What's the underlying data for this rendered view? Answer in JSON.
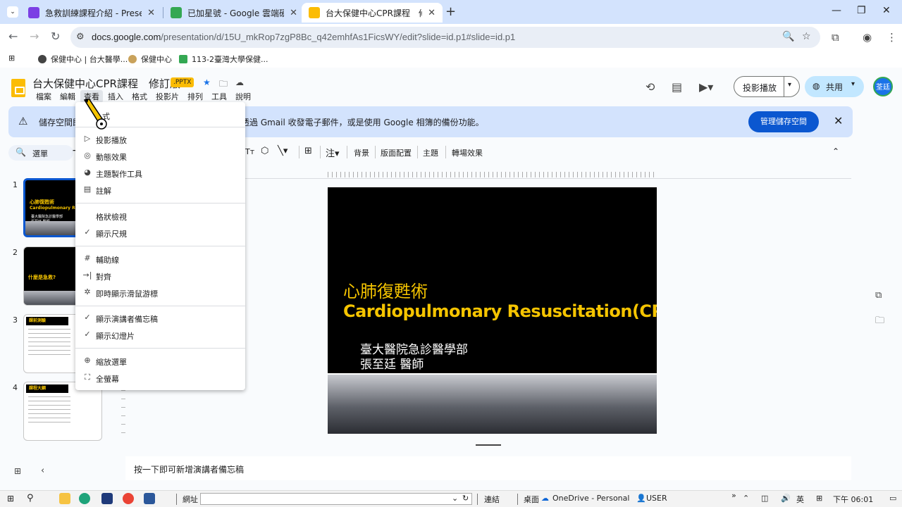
{
  "browser": {
    "tabs": [
      {
        "title": "急救訓練課程介紹 - Presentati",
        "color": "#7b3fe4"
      },
      {
        "title": "已加星號 - Google 雲端硬碟",
        "color": "#34a853"
      },
      {
        "title": "台大保健中心CPR課程　修訂版",
        "color": "#fbbc04"
      }
    ],
    "url_host": "docs.google.com",
    "url_path": "/presentation/d/15U_mkRop7zgP8Bc_q42emhfAs1FicsWY/edit?slide=id.p1#slide=id.p1",
    "bookmarks": [
      {
        "label": "保健中心 | 台大醫學...",
        "color": "#444444"
      },
      {
        "label": "保健中心",
        "color": "#c9a25b"
      },
      {
        "label": "113-2臺灣大學保健...",
        "color": "#34a853"
      }
    ]
  },
  "doc": {
    "title": "台大保健中心CPR課程　修訂版",
    "badge": ".PPTX",
    "menus": [
      "檔案",
      "編輯",
      "查看",
      "插入",
      "格式",
      "投影片",
      "排列",
      "工具",
      "說明"
    ],
    "present_label": "投影播放",
    "share_label": "共用",
    "avatar_text": "荃廷"
  },
  "banner": {
    "message_left": "儲存空間即",
    "message_right": "透過 Gmail 收發電子郵件，或是使用 Google 相簿的備份功能。",
    "manage_label": "管理儲存空間"
  },
  "toolbar": {
    "search_label": "選單",
    "items": [
      "背景",
      "版面配置",
      "主題",
      "轉場效果"
    ]
  },
  "view_menu": {
    "top_partial": "式",
    "groups": [
      [
        {
          "label": "投影播放",
          "icon": "▷"
        },
        {
          "label": "動態效果",
          "icon": "◎"
        },
        {
          "label": "主題製作工具",
          "icon": "◕"
        },
        {
          "label": "註解",
          "icon": "▤"
        }
      ],
      [
        {
          "label": "格狀檢視",
          "icon": ""
        },
        {
          "label": "顯示尺規",
          "icon": "✓"
        }
      ],
      [
        {
          "label": "輔助線",
          "icon": "#"
        },
        {
          "label": "對齊",
          "icon": "→|"
        },
        {
          "label": "即時顯示滑鼠游標",
          "icon": "✲"
        }
      ],
      [
        {
          "label": "顯示演講者備忘稿",
          "icon": "✓"
        },
        {
          "label": "顯示幻燈片",
          "icon": "✓"
        }
      ],
      [
        {
          "label": "縮放選單",
          "icon": "⊕"
        },
        {
          "label": "全螢幕",
          "icon": "⛶"
        }
      ]
    ]
  },
  "filmstrip": {
    "slides": [
      {
        "num": "1",
        "title": "心肺復甦術",
        "sub": "Cardiopulmonary Resusc",
        "line1": "臺大醫院急診醫學部",
        "line2": "張至廷 醫師"
      },
      {
        "num": "2",
        "title": "什麼是急救?"
      },
      {
        "num": "3",
        "title": "課前測驗"
      },
      {
        "num": "4",
        "title": "課程大綱"
      }
    ]
  },
  "slide": {
    "title_zh": "心肺復甦術",
    "title_en": "Cardiopulmonary Resuscitation(CPR)",
    "dept": "臺大醫院急診醫學部",
    "doctor": "張至廷 醫師"
  },
  "notes": {
    "placeholder": "按一下即可新增演講者備忘稿"
  },
  "taskbar": {
    "address_label": "網址",
    "links_label": "連結",
    "desktop_label": "桌面",
    "onedrive_label": "OneDrive - Personal",
    "user_label": "USER",
    "ime_label": "英",
    "time": "下午 06:01"
  }
}
